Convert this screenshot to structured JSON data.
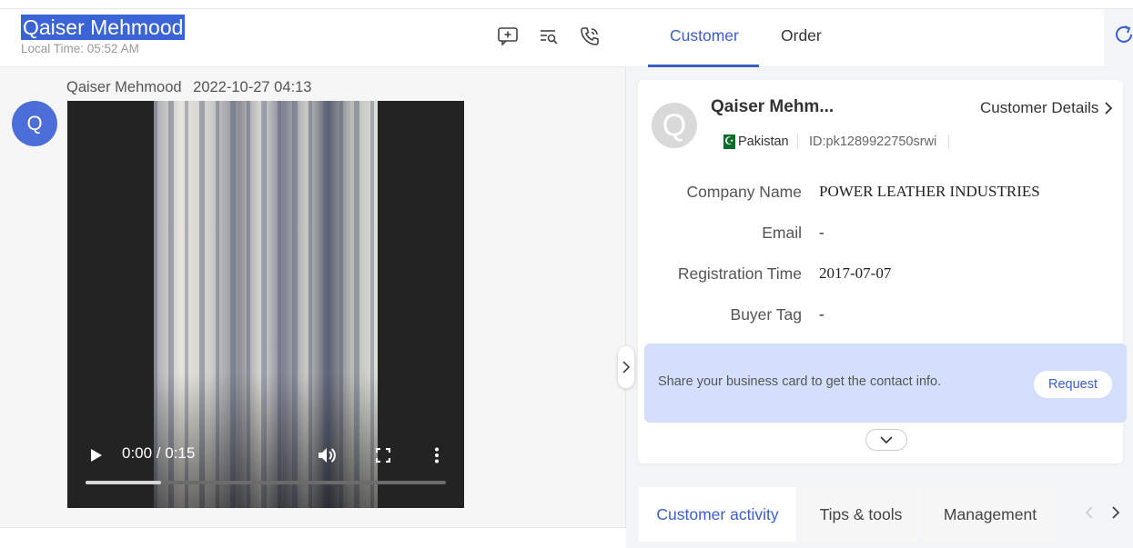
{
  "chat": {
    "contact_name": "Qaiser Mehmood",
    "local_time": "Local Time: 05:52 AM",
    "header_icons": [
      "add-comment-icon",
      "search-list-icon",
      "call-history-icon"
    ]
  },
  "message": {
    "sender": "Qaiser Mehmood",
    "timestamp": "2022-10-27 04:13",
    "avatar_letter": "Q",
    "video": {
      "time": "0:00 / 0:15",
      "progress_fraction": 0.21
    }
  },
  "tabs": {
    "customer": "Customer",
    "order": "Order"
  },
  "customer": {
    "avatar_letter": "Q",
    "name": "Qaiser Mehm...",
    "details_link": "Customer Details",
    "country": "Pakistan",
    "id": "ID:pk1289922750srwi",
    "fields": [
      {
        "label": "Company Name",
        "value": "POWER LEATHER INDUSTRIES"
      },
      {
        "label": "Email",
        "value": "-"
      },
      {
        "label": "Registration Time",
        "value": "2017-07-07"
      },
      {
        "label": "Buyer Tag",
        "value": "-"
      }
    ],
    "banner_text": "Share your business card to get the contact info.",
    "request_label": "Request"
  },
  "bottom_tabs": [
    "Customer activity",
    "Tips & tools",
    "Management"
  ],
  "colors": {
    "accent": "#3a5fc8",
    "banner": "#d4e0fb",
    "avatar_chat": "#4c6ed8",
    "selection": "#3a63d6"
  }
}
